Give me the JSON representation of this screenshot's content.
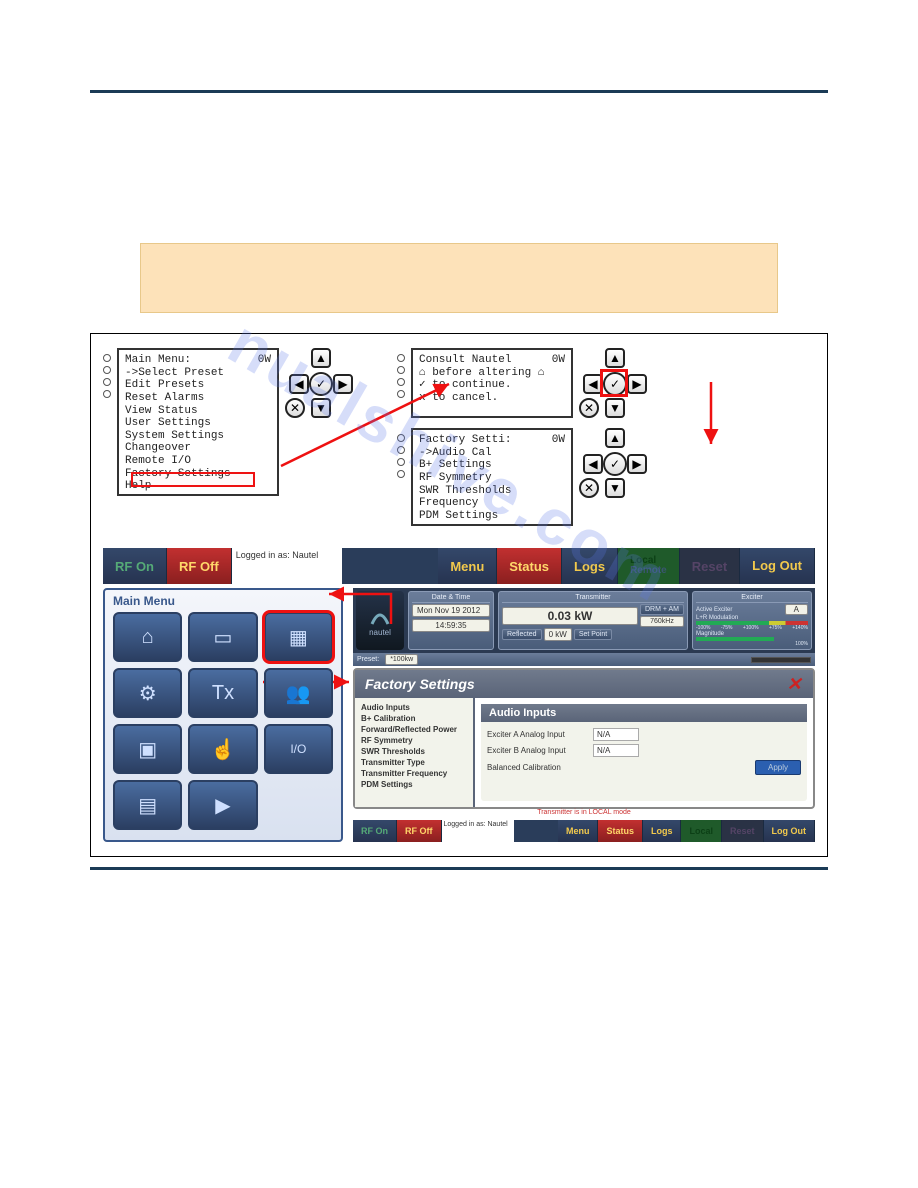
{
  "watermark": "nualshive.com",
  "lcd_main": {
    "title": "Main Menu:",
    "power": "0W",
    "items": [
      "->Select Preset",
      "  Edit Presets",
      "  Reset Alarms",
      "  View Status",
      "  User Settings",
      "  System Settings",
      "  Changeover",
      "  Remote I/O",
      "  Factory Settings",
      "  Help"
    ]
  },
  "lcd_consult": {
    "title": "Consult Nautel",
    "power": "0W",
    "lines": [
      "⌂ before altering  ⌂",
      "  ✓ to continue.",
      "  x to cancel."
    ]
  },
  "lcd_factory": {
    "title": "Factory Setti:",
    "power": "0W",
    "items": [
      "->Audio Cal",
      "  B+ Settings",
      "  RF Symmetry",
      "  SWR Thresholds",
      "  Frequency",
      "  PDM Settings"
    ]
  },
  "toolbar": {
    "rf_on": "RF On",
    "rf_off": "RF Off",
    "login": "Logged in as: Nautel",
    "menu": "Menu",
    "status": "Status",
    "logs": "Logs",
    "local": "Local",
    "remote": "Remote",
    "reset": "Reset",
    "logout": "Log Out"
  },
  "main_menu": {
    "title": "Main Menu",
    "cells": [
      {
        "name": "home",
        "icon": "⌂"
      },
      {
        "name": "presets",
        "icon": "▭"
      },
      {
        "name": "factory-settings",
        "icon": "▦"
      },
      {
        "name": "system-settings",
        "icon": "⚙"
      },
      {
        "name": "precorrection",
        "icon": "Tx"
      },
      {
        "name": "user-accounts",
        "icon": "👥"
      },
      {
        "name": "changeover",
        "icon": "▣"
      },
      {
        "name": "user-settings",
        "icon": "☝"
      },
      {
        "name": "remote-io",
        "icon": "I/O"
      },
      {
        "name": "scheduler",
        "icon": "▤"
      },
      {
        "name": "audio-player",
        "icon": "▶"
      }
    ]
  },
  "aui": {
    "logo": "nautel",
    "datetime": {
      "hdr": "Date & Time",
      "date": "Mon Nov 19 2012",
      "time": "14:59:35"
    },
    "transmitter": {
      "hdr": "Transmitter",
      "power_val": "0.03 kW",
      "reflected_lbl": "Reflected",
      "reflected_val": "0 kW",
      "setpoint_lbl": "Set Point",
      "mode": "DRM + AM",
      "freq": "760kHz",
      "preset_lbl": "Preset:",
      "preset_val": "*100kw"
    },
    "exciter": {
      "hdr": "Exciter",
      "active_lbl": "Active Exciter",
      "active_val": "A",
      "mod_lbl": "L+R Modulation",
      "mag_lbl": "Magnitude",
      "scale": [
        "-100%",
        "-75%",
        "+100%",
        "+75%",
        "+140%"
      ],
      "pct": "100%"
    },
    "x_close": "✕",
    "panel_title": "Factory Settings",
    "side_items": [
      "Audio Inputs",
      "B+ Calibration",
      "Forward/Reflected Power",
      "RF Symmetry",
      "SWR Thresholds",
      "Transmitter Type",
      "Transmitter Frequency",
      "PDM Settings"
    ],
    "main_hdr": "Audio Inputs",
    "form": {
      "r1_lbl": "Exciter A Analog Input",
      "r1_val": "N/A",
      "r2_lbl": "Exciter B Analog Input",
      "r2_val": "N/A",
      "r3_lbl": "Balanced Calibration",
      "apply": "Apply"
    },
    "status_line": "Transmitter is in LOCAL mode"
  },
  "footer": {
    "rf_on": "RF On",
    "rf_off": "RF Off",
    "login": "Logged in as: Nautel",
    "menu": "Menu",
    "status": "Status",
    "logs": "Logs",
    "local": "Local",
    "reset": "Reset",
    "logout": "Log Out"
  }
}
